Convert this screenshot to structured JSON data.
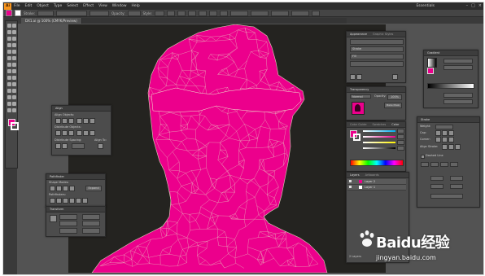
{
  "colors": {
    "accent_magenta": "#ec008c",
    "app_background": "#3a3a3a",
    "artboard_background": "#242320",
    "panel_background": "#4c4c4c",
    "mesh_stroke": "#e8e6c8"
  },
  "menubar": {
    "app_logo": "Ai",
    "items": [
      "File",
      "Edit",
      "Object",
      "Type",
      "Select",
      "Effect",
      "View",
      "Window",
      "Help"
    ],
    "workspace": "Essentials"
  },
  "document_tab": {
    "label": "DX1.ai @ 100% (CMYK/Preview)"
  },
  "control_bar": {
    "stroke_label": "Stroke:",
    "style_label": "Style:",
    "opacity_label": "Opacity:"
  },
  "panels": {
    "align": {
      "tab": "Align",
      "rows": [
        "Align Objects:",
        "Distribute Objects:",
        "Distribute Spacing:"
      ],
      "align_to": "Align To:"
    },
    "pathfinder": {
      "tab": "Pathfinder",
      "rows": [
        "Shape Modes:",
        "Pathfinders:"
      ],
      "expand": "Expand"
    },
    "transform": {
      "tab": "Transform"
    },
    "appearance": {
      "tabs": [
        "Appearance",
        "Graphic Styles"
      ],
      "rows": [
        "Stroke",
        "Fill"
      ]
    },
    "transparency": {
      "tabs": [
        "Transparency"
      ],
      "mode": "Normal",
      "opacity_label": "Opacity:",
      "opacity": "100%",
      "make_mask": "Make Mask"
    },
    "color": {
      "tabs": [
        "Color Guide",
        "Swatches",
        "Color"
      ]
    },
    "layers": {
      "tabs": [
        "Layers",
        "Artboards"
      ],
      "rows": [
        {
          "name": "Layer 2",
          "thumb": "magenta"
        },
        {
          "name": "Layer 1",
          "thumb": "white"
        }
      ],
      "footer": "2 Layers"
    },
    "gradient": {
      "tab": "Gradient"
    },
    "stroke": {
      "tabs": [
        "Stroke"
      ],
      "weight_label": "Weight:",
      "cap_label": "Cap:",
      "corner_label": "Corner:",
      "align_label": "Align Stroke:",
      "dashed_label": "Dashed Line"
    }
  },
  "watermark": {
    "logo_text": "Baidu经验",
    "url": "jingyan.baidu.com"
  }
}
